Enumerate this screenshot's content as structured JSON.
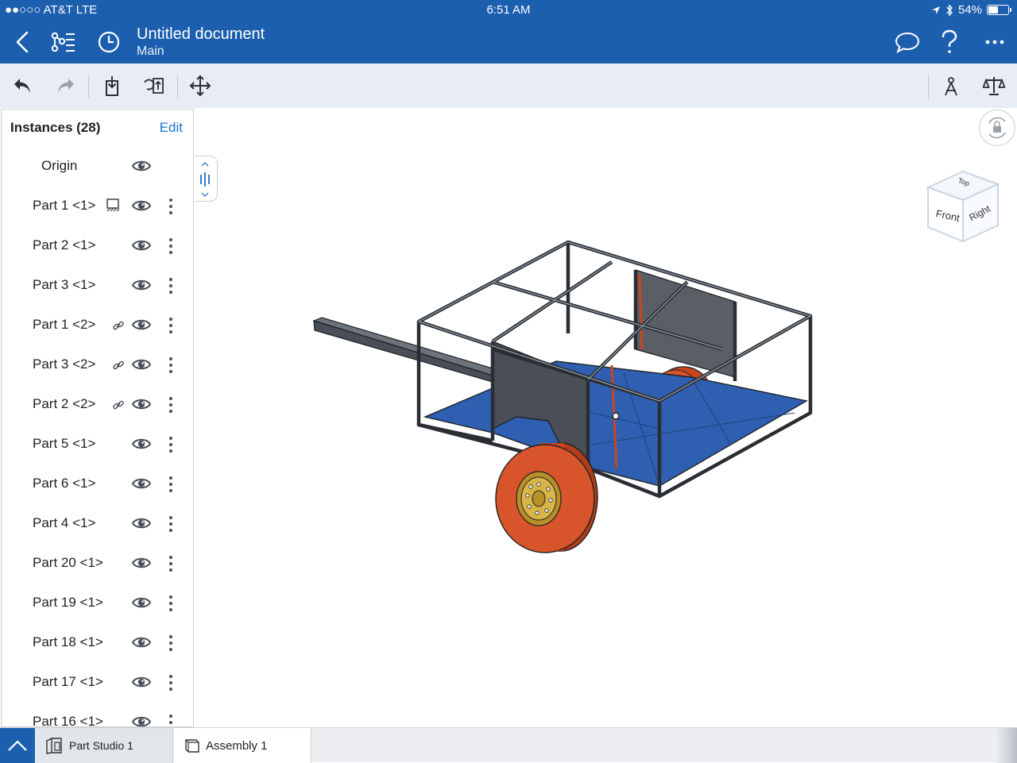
{
  "status_bar": {
    "carrier": "●●○○○ AT&T  LTE",
    "time": "6:51 AM",
    "battery_text": "54%",
    "battery_level": 0.54
  },
  "nav": {
    "title": "Untitled document",
    "subtitle": "Main",
    "icons": [
      "back-chevron-icon",
      "feature-tree-icon",
      "history-clock-icon",
      "comment-bubble-icon",
      "help-question-icon",
      "more-ellipsis-icon"
    ]
  },
  "toolbar": {
    "icons": [
      "undo-icon",
      "redo-icon",
      "insert-part-icon",
      "replace-icon",
      "move-arrows-icon",
      "mate-connector-icon",
      "mass-properties-icon"
    ]
  },
  "instances": {
    "title": "Instances (28)",
    "edit_label": "Edit",
    "items": [
      {
        "label": "Origin",
        "menu": false,
        "badge": "none"
      },
      {
        "label": "Part 1 <1>",
        "menu": true,
        "badge": "fixed"
      },
      {
        "label": "Part 2 <1>",
        "menu": true,
        "badge": "none"
      },
      {
        "label": "Part 3 <1>",
        "menu": true,
        "badge": "none"
      },
      {
        "label": "Part 1 <2>",
        "menu": true,
        "badge": "link"
      },
      {
        "label": "Part 3 <2>",
        "menu": true,
        "badge": "link"
      },
      {
        "label": "Part 2 <2>",
        "menu": true,
        "badge": "link"
      },
      {
        "label": "Part 5 <1>",
        "menu": true,
        "badge": "none"
      },
      {
        "label": "Part 6 <1>",
        "menu": true,
        "badge": "none"
      },
      {
        "label": "Part 4 <1>",
        "menu": true,
        "badge": "none"
      },
      {
        "label": "Part 20 <1>",
        "menu": true,
        "badge": "none"
      },
      {
        "label": "Part 19 <1>",
        "menu": true,
        "badge": "none"
      },
      {
        "label": "Part 18 <1>",
        "menu": true,
        "badge": "none"
      },
      {
        "label": "Part 17 <1>",
        "menu": true,
        "badge": "none"
      },
      {
        "label": "Part 16 <1>",
        "menu": true,
        "badge": "none"
      }
    ]
  },
  "view_cube": {
    "top": "Top",
    "front": "Front",
    "right": "Right"
  },
  "bottom_tabs": [
    {
      "label": "Part Studio 1"
    },
    {
      "label": "Assembly 1"
    }
  ],
  "colors": {
    "brand": "#1c5fae",
    "accent_link": "#1a73d0",
    "frame": "#4a4f57",
    "floor": "#2f5fb0",
    "wheel": "#d8542a"
  }
}
